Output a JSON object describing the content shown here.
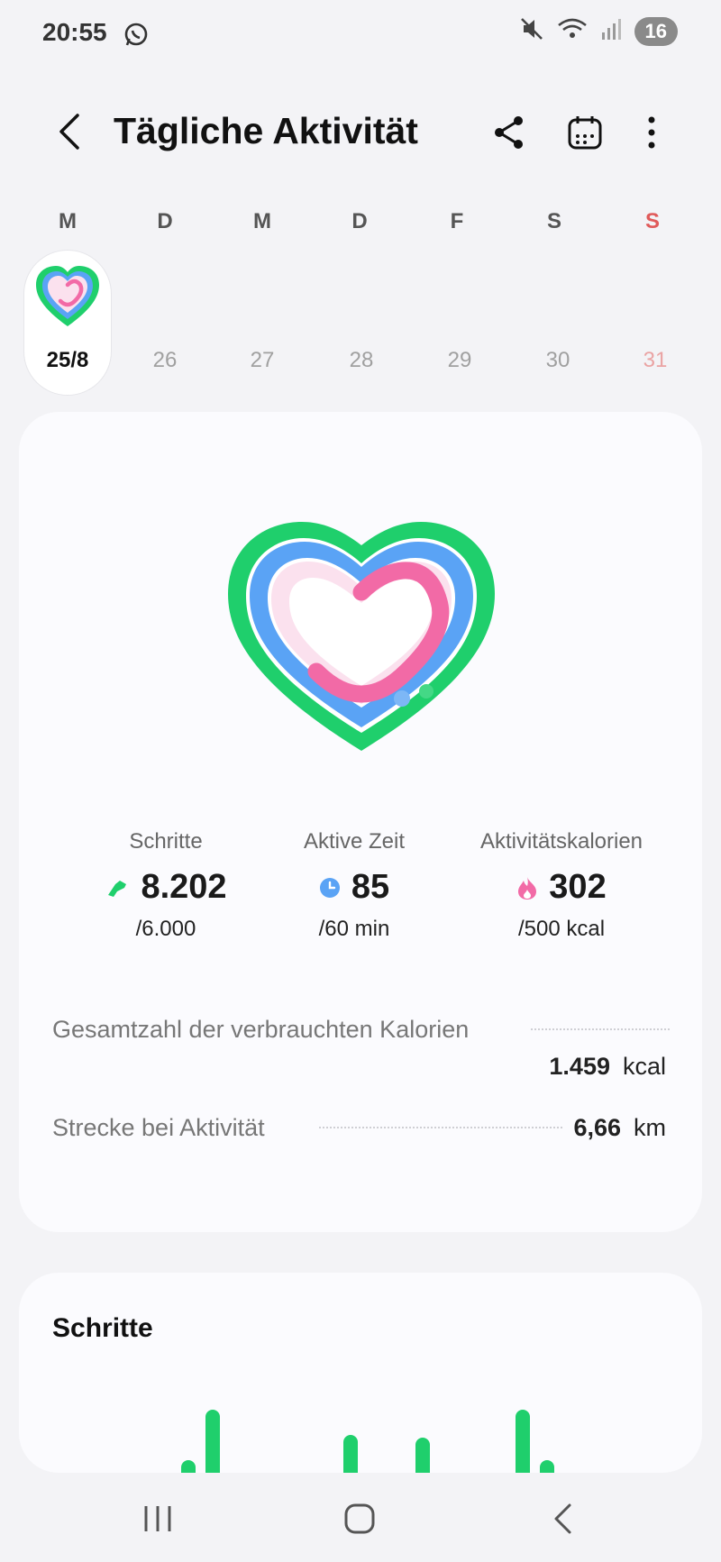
{
  "status_bar": {
    "time": "20:55",
    "battery": "16"
  },
  "header": {
    "title": "Tägliche Aktivität"
  },
  "week": {
    "day_letters": [
      "M",
      "D",
      "M",
      "D",
      "F",
      "S",
      "S"
    ],
    "dates": [
      "25/8",
      "26",
      "27",
      "28",
      "29",
      "30",
      "31"
    ],
    "selected_index": 0
  },
  "summary": {
    "steps": {
      "label": "Schritte",
      "value": "8.202",
      "goal": "/6.000",
      "progress": 1.0
    },
    "active_time": {
      "label": "Aktive Zeit",
      "value": "85",
      "goal": "/60 min",
      "progress": 1.0
    },
    "active_calories": {
      "label": "Aktivitätskalorien",
      "value": "302",
      "goal": "/500 kcal",
      "progress": 0.6
    },
    "total_calories": {
      "label": "Gesamtzahl der verbrauchten Kalorien",
      "value": "1.459",
      "unit": "kcal"
    },
    "distance": {
      "label": "Strecke bei Aktivität",
      "value": "6,66",
      "unit": "km"
    }
  },
  "steps_card": {
    "title": "Schritte"
  },
  "colors": {
    "steps_green": "#1fcf6c",
    "time_blue": "#5aa3f5",
    "calories_pink": "#f26aa6",
    "sunday_red": "#e05a5a"
  },
  "chart_data": {
    "type": "bar",
    "values": [
      0.1,
      1.0,
      0.6,
      0.55,
      1.0,
      0.1
    ],
    "note_visible": false
  }
}
